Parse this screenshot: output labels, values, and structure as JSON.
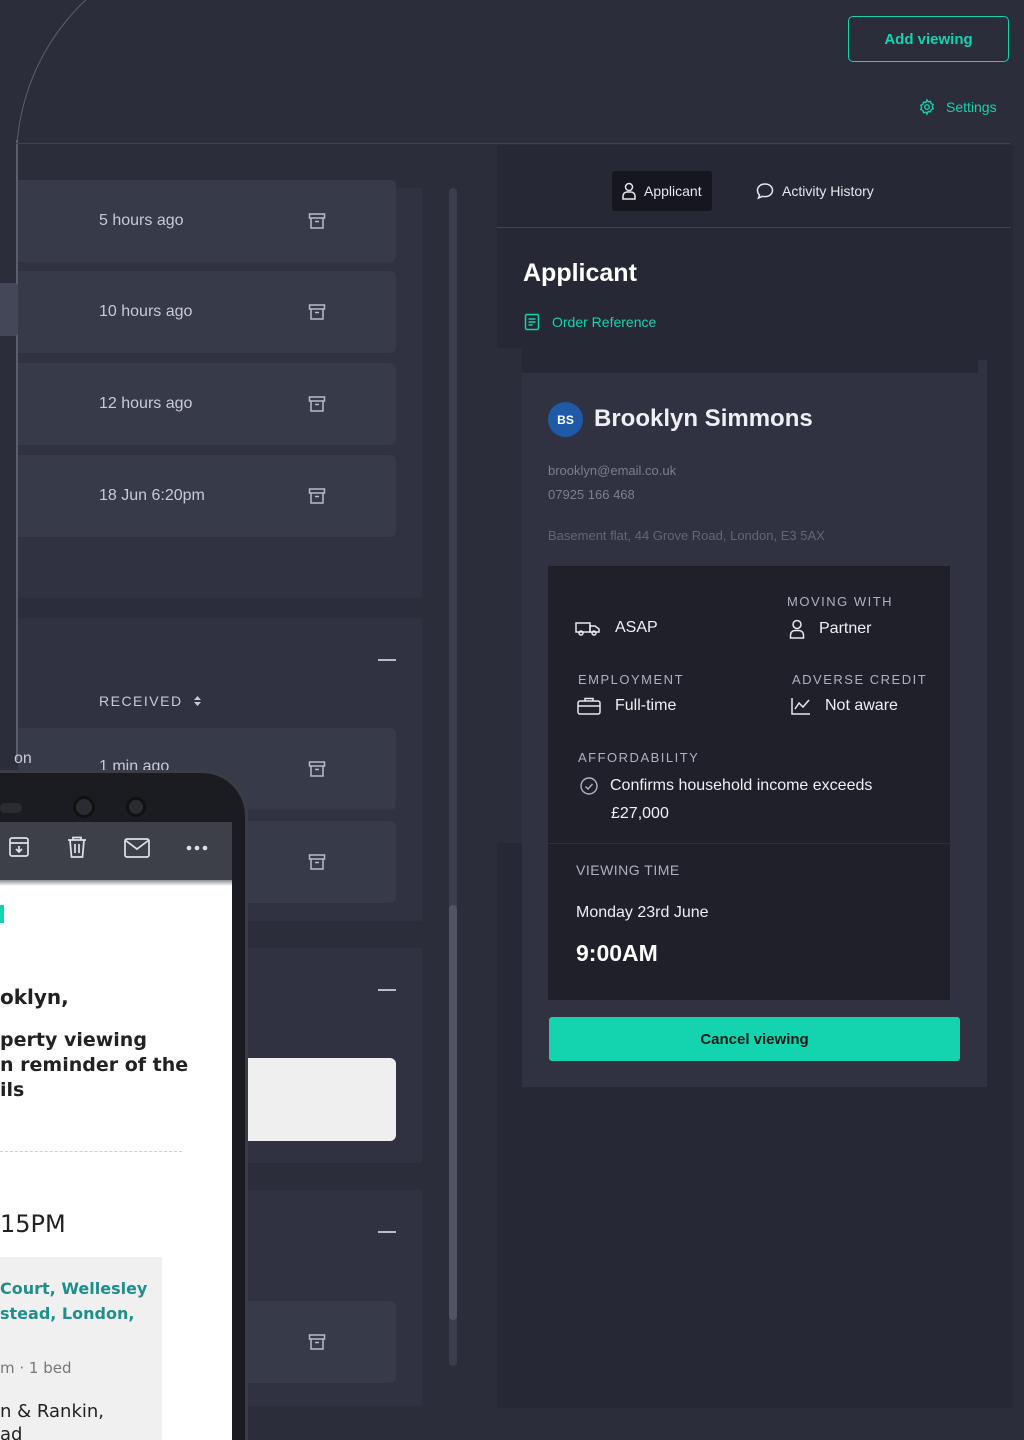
{
  "header": {
    "add_viewing_label": "Add viewing",
    "settings_label": "Settings",
    "accent": "#14d4b0"
  },
  "list": {
    "rows_top": [
      {
        "time": "5 hours ago"
      },
      {
        "time": "10 hours ago"
      },
      {
        "time": "12 hours ago"
      },
      {
        "time": "18 Jun 6:20pm"
      }
    ],
    "received_label": "RECEIVED",
    "row_partial_time": "1 min ago",
    "partial_text": "on"
  },
  "phone": {
    "greeting": "oklyn,",
    "line1": "perty viewing",
    "line2": "n reminder of the",
    "line3": "ils",
    "time": "15PM",
    "address1": "Court, Wellesley",
    "address2": "stead, London,",
    "meta": "m · 1 bed",
    "agent1": "n & Rankin,",
    "agent2": "ad"
  },
  "detail": {
    "tabs": [
      {
        "label": "Applicant",
        "icon": "person-icon",
        "active": true
      },
      {
        "label": "Activity History",
        "icon": "chat-bubble-icon",
        "active": false
      }
    ],
    "heading": "Applicant",
    "order_reference_label": "Order Reference",
    "applicant": {
      "initials": "BS",
      "name": "Brooklyn Simmons",
      "email": "brooklyn@email.co.uk",
      "phone": "07925 166 468",
      "address": "Basement flat, 44 Grove Road, London, E3 5AX",
      "moving_date": "ASAP",
      "moving_with_label": "MOVING WITH",
      "moving_with": "Partner",
      "employment_label": "EMPLOYMENT",
      "employment": "Full-time",
      "adverse_credit_label": "ADVERSE CREDIT",
      "adverse_credit": "Not aware",
      "affordability_label": "AFFORDABILITY",
      "affordability_line1": "Confirms household income exceeds",
      "affordability_line2": "£27,000"
    },
    "viewing_time_label": "VIEWING TIME",
    "viewing_date": "Monday 23rd June",
    "viewing_time": "9:00AM",
    "cancel_label": "Cancel viewing"
  }
}
